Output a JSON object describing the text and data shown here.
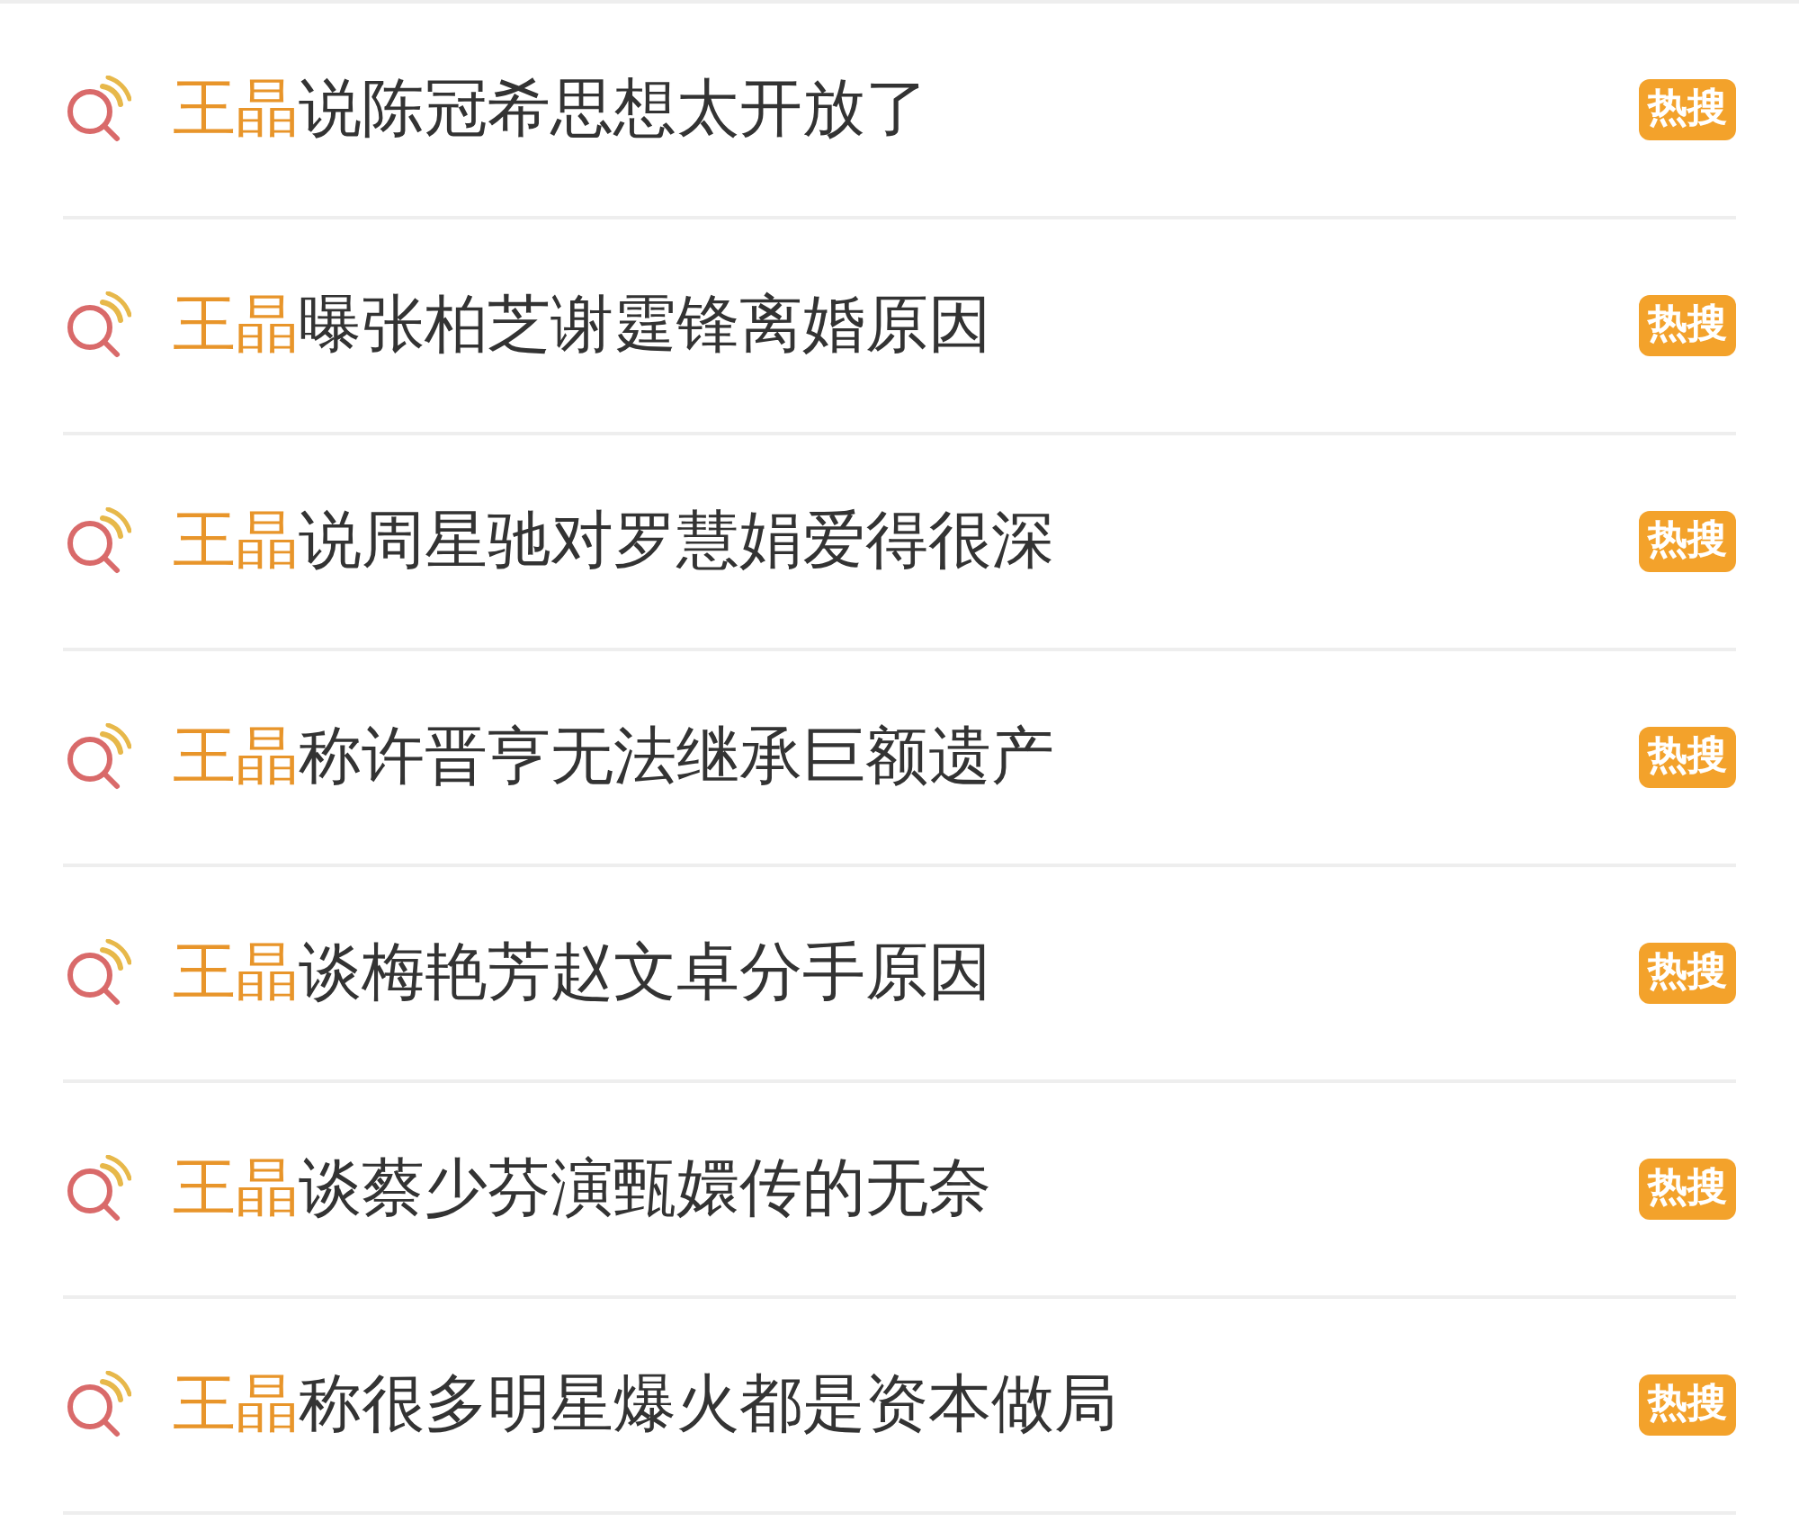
{
  "results": [
    {
      "highlight": "王晶",
      "rest": "说陈冠希思想太开放了",
      "badge": "热搜"
    },
    {
      "highlight": "王晶",
      "rest": "曝张柏芝谢霆锋离婚原因",
      "badge": "热搜"
    },
    {
      "highlight": "王晶",
      "rest": "说周星驰对罗慧娟爱得很深",
      "badge": "热搜"
    },
    {
      "highlight": "王晶",
      "rest": "称许晋亨无法继承巨额遗产",
      "badge": "热搜"
    },
    {
      "highlight": "王晶",
      "rest": "谈梅艳芳赵文卓分手原因",
      "badge": "热搜"
    },
    {
      "highlight": "王晶",
      "rest": "谈蔡少芬演甄嬛传的无奈",
      "badge": "热搜"
    },
    {
      "highlight": "王晶",
      "rest": "称很多明星爆火都是资本做局",
      "badge": "热搜"
    }
  ]
}
